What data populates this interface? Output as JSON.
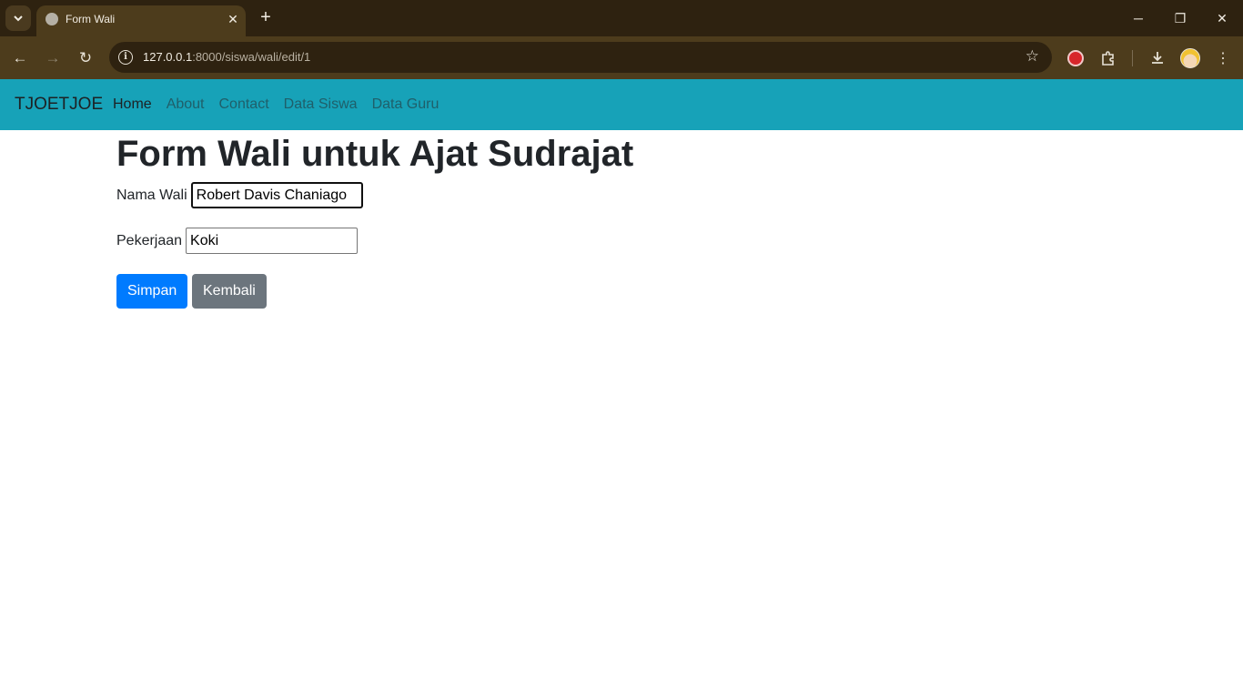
{
  "browser": {
    "tab_title": "Form Wali",
    "url_host": "127.0.0.1",
    "url_path": ":8000/siswa/wali/edit/1"
  },
  "navbar": {
    "brand": "TJOETJOE",
    "links": [
      {
        "label": "Home",
        "active": true
      },
      {
        "label": "About"
      },
      {
        "label": "Contact"
      },
      {
        "label": "Data Siswa"
      },
      {
        "label": "Data Guru"
      }
    ]
  },
  "form": {
    "title": "Form Wali untuk Ajat Sudrajat",
    "nama_wali_label": "Nama Wali",
    "nama_wali_value": "Robert Davis Chaniago",
    "pekerjaan_label": "Pekerjaan",
    "pekerjaan_value": "Koki",
    "save_label": "Simpan",
    "back_label": "Kembali"
  },
  "colors": {
    "navbar": "#17a2b8",
    "primary": "#007bff",
    "secondary": "#6c757d"
  },
  "icons": [
    "tab-search-icon",
    "globe-icon",
    "close-icon",
    "plus-icon",
    "back-arrow-icon",
    "forward-arrow-icon",
    "reload-icon",
    "info-icon",
    "star-icon",
    "extension-icon",
    "puzzle-icon",
    "download-icon",
    "avatar",
    "kebab-menu-icon",
    "minimize-icon",
    "restore-icon",
    "window-close-icon"
  ]
}
